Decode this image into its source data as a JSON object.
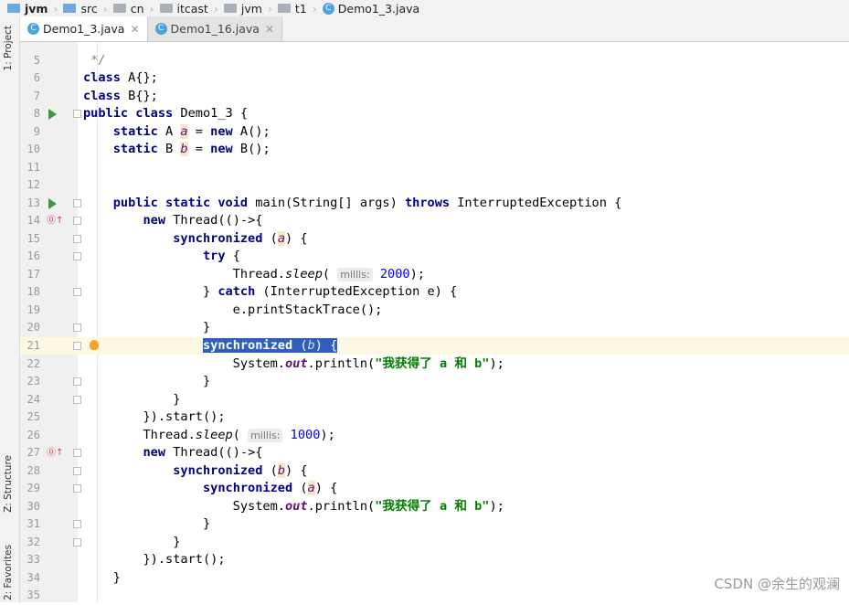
{
  "breadcrumbs": [
    "jvm",
    "src",
    "cn",
    "itcast",
    "jvm",
    "t1",
    "Demo1_3.java"
  ],
  "tabs": [
    {
      "label": "Demo1_3.java",
      "active": true
    },
    {
      "label": "Demo1_16.java",
      "active": false
    }
  ],
  "left_tool_tabs": [
    "1: Project",
    "Z: Structure",
    "2: Favorites"
  ],
  "watermark": "CSDN @余生的观澜",
  "colors": {
    "keyword": "#000080",
    "field": "#660e7a",
    "string": "#008000",
    "number": "#0000ff",
    "selection": "#2f5fb8",
    "current_line": "#fcf8e1"
  },
  "lines": [
    {
      "n": "5",
      "t": [
        [
          "c",
          " */"
        ]
      ]
    },
    {
      "n": "6",
      "t": [
        [
          "k",
          "class"
        ],
        [
          "p",
          " A{};"
        ]
      ]
    },
    {
      "n": "7",
      "t": [
        [
          "k",
          "class"
        ],
        [
          "p",
          " B{};"
        ]
      ]
    },
    {
      "n": "8",
      "icon": "run-icon",
      "fold": true,
      "t": [
        [
          "k",
          "public class"
        ],
        [
          "p",
          " Demo1_3 {"
        ]
      ]
    },
    {
      "n": "9",
      "t": [
        [
          "p",
          "    "
        ],
        [
          "k",
          "static"
        ],
        [
          "p",
          " A "
        ],
        [
          "f",
          "a"
        ],
        [
          "p",
          " = "
        ],
        [
          "k",
          "new"
        ],
        [
          "p",
          " A();"
        ]
      ]
    },
    {
      "n": "10",
      "t": [
        [
          "p",
          "    "
        ],
        [
          "k",
          "static"
        ],
        [
          "p",
          " B "
        ],
        [
          "f",
          "b"
        ],
        [
          "p",
          " = "
        ],
        [
          "k",
          "new"
        ],
        [
          "p",
          " B();"
        ]
      ]
    },
    {
      "n": "11",
      "t": []
    },
    {
      "n": "12",
      "t": []
    },
    {
      "n": "13",
      "icon": "run-icon",
      "fold": true,
      "t": [
        [
          "p",
          "    "
        ],
        [
          "k",
          "public static void"
        ],
        [
          "p",
          " main(String[] args) "
        ],
        [
          "k",
          "throws"
        ],
        [
          "p",
          " InterruptedException {"
        ]
      ]
    },
    {
      "n": "14",
      "icon": "override-icon",
      "fold": true,
      "t": [
        [
          "p",
          "        "
        ],
        [
          "k",
          "new"
        ],
        [
          "p",
          " Thread(()->{"
        ]
      ]
    },
    {
      "n": "15",
      "fold": true,
      "t": [
        [
          "p",
          "            "
        ],
        [
          "k",
          "synchronized"
        ],
        [
          "p",
          " ("
        ],
        [
          "f",
          "a"
        ],
        [
          "p",
          ") {"
        ]
      ]
    },
    {
      "n": "16",
      "fold": true,
      "t": [
        [
          "p",
          "                "
        ],
        [
          "k",
          "try"
        ],
        [
          "p",
          " {"
        ]
      ]
    },
    {
      "n": "17",
      "t": [
        [
          "p",
          "                    Thread."
        ],
        [
          "m",
          "sleep"
        ],
        [
          "p",
          "( "
        ],
        [
          "h",
          "millis:"
        ],
        [
          "p",
          " "
        ],
        [
          "n",
          "2000"
        ],
        [
          "p",
          ");"
        ]
      ]
    },
    {
      "n": "18",
      "fold": true,
      "t": [
        [
          "p",
          "                } "
        ],
        [
          "k",
          "catch"
        ],
        [
          "p",
          " (InterruptedException e) {"
        ]
      ]
    },
    {
      "n": "19",
      "t": [
        [
          "p",
          "                    e.printStackTrace();"
        ]
      ]
    },
    {
      "n": "20",
      "fold": true,
      "t": [
        [
          "p",
          "                }"
        ]
      ]
    },
    {
      "n": "21",
      "icon": "bulb-icon",
      "fold": true,
      "current": true,
      "t": [
        [
          "p",
          "                "
        ],
        [
          "sel",
          ""
        ],
        [
          "k",
          "synchronized"
        ],
        [
          "p",
          " ("
        ],
        [
          "f",
          "b"
        ],
        [
          "p",
          ") {"
        ]
      ]
    },
    {
      "n": "22",
      "t": [
        [
          "p",
          "                    System."
        ],
        [
          "o",
          "out"
        ],
        [
          "p",
          ".println("
        ],
        [
          "s",
          "\"我获得了 a 和 b\""
        ],
        [
          "p",
          ");"
        ]
      ]
    },
    {
      "n": "23",
      "fold": true,
      "t": [
        [
          "p",
          "                }"
        ]
      ]
    },
    {
      "n": "24",
      "fold": true,
      "t": [
        [
          "p",
          "            }"
        ]
      ]
    },
    {
      "n": "25",
      "t": [
        [
          "p",
          "        }).start();"
        ]
      ]
    },
    {
      "n": "26",
      "t": [
        [
          "p",
          "        Thread."
        ],
        [
          "m",
          "sleep"
        ],
        [
          "p",
          "( "
        ],
        [
          "h",
          "millis:"
        ],
        [
          "p",
          " "
        ],
        [
          "n",
          "1000"
        ],
        [
          "p",
          ");"
        ]
      ]
    },
    {
      "n": "27",
      "icon": "override-icon",
      "fold": true,
      "t": [
        [
          "p",
          "        "
        ],
        [
          "k",
          "new"
        ],
        [
          "p",
          " Thread(()->{"
        ]
      ]
    },
    {
      "n": "28",
      "fold": true,
      "t": [
        [
          "p",
          "            "
        ],
        [
          "k",
          "synchronized"
        ],
        [
          "p",
          " ("
        ],
        [
          "f",
          "b"
        ],
        [
          "p",
          ") {"
        ]
      ]
    },
    {
      "n": "29",
      "fold": true,
      "t": [
        [
          "p",
          "                "
        ],
        [
          "k",
          "synchronized"
        ],
        [
          "p",
          " ("
        ],
        [
          "f",
          "a"
        ],
        [
          "p",
          ") {"
        ]
      ]
    },
    {
      "n": "30",
      "t": [
        [
          "p",
          "                    System."
        ],
        [
          "o",
          "out"
        ],
        [
          "p",
          ".println("
        ],
        [
          "s",
          "\"我获得了 a 和 b\""
        ],
        [
          "p",
          ");"
        ]
      ]
    },
    {
      "n": "31",
      "fold": true,
      "t": [
        [
          "p",
          "                }"
        ]
      ]
    },
    {
      "n": "32",
      "fold": true,
      "t": [
        [
          "p",
          "            }"
        ]
      ]
    },
    {
      "n": "33",
      "t": [
        [
          "p",
          "        }).start();"
        ]
      ]
    },
    {
      "n": "34",
      "t": [
        [
          "p",
          "    }"
        ]
      ]
    },
    {
      "n": "35",
      "t": []
    }
  ]
}
